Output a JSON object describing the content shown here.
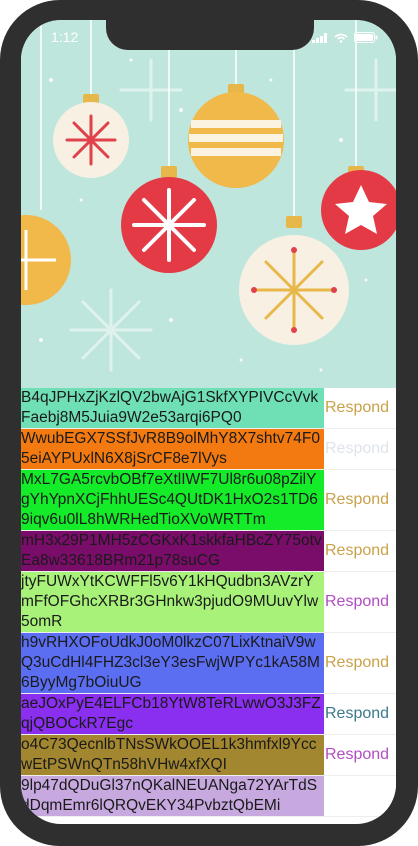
{
  "status_bar": {
    "time": "1:12"
  },
  "rows": [
    {
      "text": "B4qJPHxZjKzlQV2bwAjG1SkfXYPIVCcVvkFaebj8M5Juia9W2e53arqi6PQ0",
      "bg": "#6fe0b6",
      "action": "Respond",
      "action_color": "#c9a24a"
    },
    {
      "text": "WwubEGX7SSfJvR8B9olMhY8X7shtv74F05eiAYPUxlN6X8jSrCF8e7lVys",
      "bg": "#f27a10",
      "action": "Respond",
      "action_color": "#dfe4ea"
    },
    {
      "text": "MxL7GA5rcvbOBf7eXtlIWF7Ul8r6u08pZilYgYhYpnXCjFhhUESc4QUtDK1HxO2s1TD69iqv6u0lL8hWRHedTioXVoWRTTm",
      "bg": "#14ec2a",
      "action": "Respond",
      "action_color": "#c9a24a"
    },
    {
      "text": "mH3x29P1MH5zCGKxK1skkfaHBcZY75otvEa8w33618BRm21p78suCG",
      "bg": "#7a0d6a",
      "action": "Respond",
      "action_color": "#c9a24a"
    },
    {
      "text": "jtyFUWxYtKCWFFl5v6Y1kHQudbn3AVzrYmFfOFGhcXRBr3GHnkw3pjudO9MUuvYlw5omR",
      "bg": "#a8f27a",
      "action": "Respond",
      "action_color": "#b14dc4"
    },
    {
      "text": "h9vRHXOFoUdkJ0oM0lkzC07LixKtnaiV9wQ3uCdHl4FHZ3cl3eY3esFwjWPYc1kA58M6ByyMg7bOiuUG",
      "bg": "#5b6ef2",
      "action": "Respond",
      "action_color": "#c9a24a"
    },
    {
      "text": "aeJOxPyE4ELFCb18YtW8TeRLwwO3J3FZqjQBOCkR7Egc",
      "bg": "#8a2ef0",
      "action": "Respond",
      "action_color": "#3a7a8a"
    },
    {
      "text": "o4C73QecnlbTNsSWkOOEL1k3hmfxl9YccwEtPSWnQTn58hVHw4xfXQI",
      "bg": "#a38730",
      "action": "Respond",
      "action_color": "#b14dc4"
    },
    {
      "text": "9lp47dQDuGl37nQKalNEUANga72YArTdSdDqmEmr6lQRQvEKY34PvbztQbEMi",
      "bg": "#c7a9e0",
      "action": "",
      "action_color": "#c9a24a"
    }
  ]
}
